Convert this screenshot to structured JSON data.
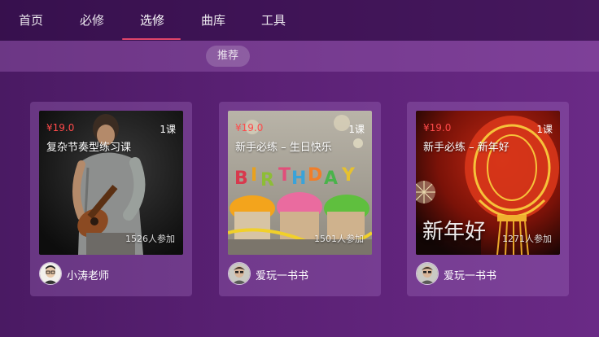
{
  "nav": {
    "tabs": [
      {
        "label": "首页"
      },
      {
        "label": "必修"
      },
      {
        "label": "选修"
      },
      {
        "label": "曲库"
      },
      {
        "label": "工具"
      }
    ],
    "active_index": 2
  },
  "filter": {
    "chips": [
      {
        "label": "推荐"
      }
    ]
  },
  "courses": [
    {
      "price": "¥19.0",
      "lessons": "1课",
      "title": "复杂节奏型练习课",
      "participants": "1526人参加",
      "author": "小涛老师"
    },
    {
      "price": "¥19.0",
      "lessons": "1课",
      "title": "新手必练 – 生日快乐",
      "participants": "1501人参加",
      "author": "爱玩一书书"
    },
    {
      "price": "¥19.0",
      "lessons": "1课",
      "title": "新手必练 – 新年好",
      "participants": "1271人参加",
      "author": "爱玩一书书",
      "image_text": "新年好"
    }
  ],
  "colors": {
    "accent": "#e0456a",
    "price": "#ff4a4a"
  }
}
